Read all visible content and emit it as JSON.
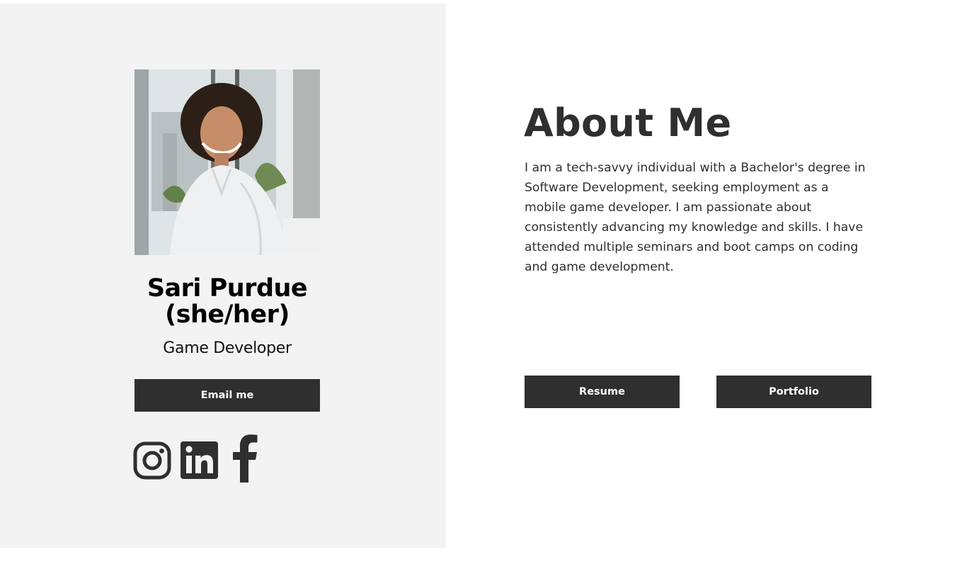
{
  "profile": {
    "name": "Sari Purdue (she/her)",
    "name_line1": "Sari Purdue",
    "name_line2": "(she/her)",
    "role": "Game Developer",
    "photo": "portrait-photo",
    "email_button": "Email me"
  },
  "social": {
    "icons": [
      "instagram-icon",
      "linkedin-icon",
      "facebook-icon"
    ],
    "color": "#2f2f2f"
  },
  "about": {
    "title": "About Me",
    "body": "I am a tech-savvy individual with a Bachelor's degree in Software Development, seeking employment as a mobile game developer. I am passionate about consistently advancing my knowledge and skills. I have attended multiple seminars and boot camps on coding and game development.",
    "resume_button": "Resume",
    "portfolio_button": "Portfolio"
  },
  "colors": {
    "panel_background": "#f3f3f3",
    "button_background": "#2f2f2f",
    "button_text": "#ffffff",
    "text": "#2f2f2f"
  }
}
